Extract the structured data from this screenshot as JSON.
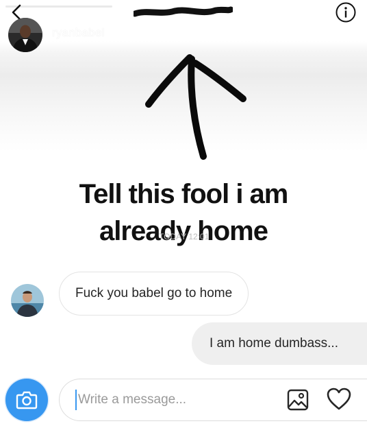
{
  "story": {
    "progress": 0.3,
    "username": "ryanbabel",
    "timestamp": "1s",
    "caption_line_1": "Tell this fool i am",
    "caption_line_2": "already home",
    "faded_overlay_text": "TODAY 12:01"
  },
  "messages": [
    {
      "direction": "received",
      "text": "Fuck you babel go to home"
    },
    {
      "direction": "sent",
      "text": "I am home dumbass..."
    }
  ],
  "composer": {
    "placeholder": "Write a message..."
  },
  "icons": {
    "back": "chevron-left-icon",
    "info": "info-icon",
    "close": "close-icon",
    "camera": "camera-icon",
    "gallery": "image-icon",
    "heart": "heart-icon"
  },
  "colors": {
    "accent": "#3797f0",
    "received_bubble_border": "#e3e3e3",
    "sent_bubble_fill": "#efefef"
  }
}
